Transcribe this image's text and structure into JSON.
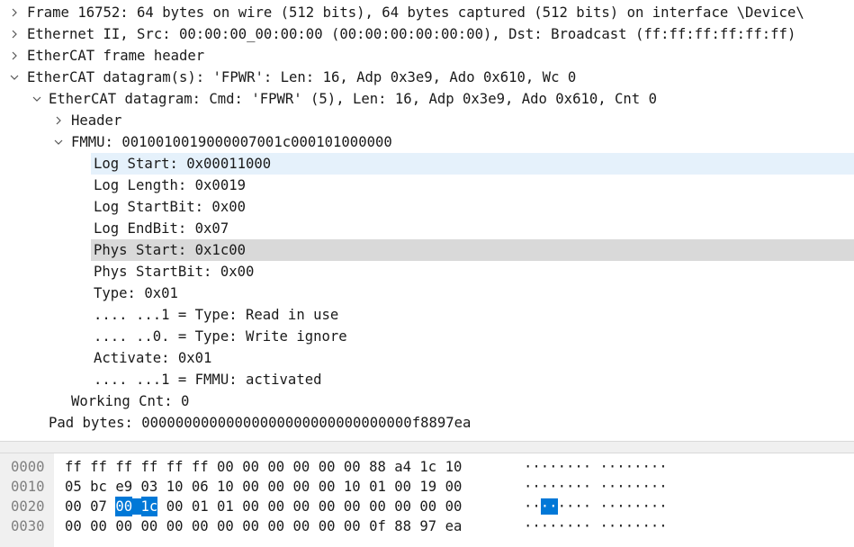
{
  "tree": [
    {
      "text": "Frame 16752: 64 bytes on wire (512 bits), 64 bytes captured (512 bits) on interface \\Device\\",
      "indent": 0,
      "arrow": "collapsed"
    },
    {
      "text": "Ethernet II, Src: 00:00:00_00:00:00 (00:00:00:00:00:00), Dst: Broadcast (ff:ff:ff:ff:ff:ff)",
      "indent": 0,
      "arrow": "collapsed"
    },
    {
      "text": "EtherCAT frame header",
      "indent": 0,
      "arrow": "collapsed"
    },
    {
      "text": "EtherCAT datagram(s): 'FPWR': Len: 16, Adp 0x3e9, Ado 0x610, Wc 0",
      "indent": 0,
      "arrow": "expanded"
    },
    {
      "text": "EtherCAT datagram: Cmd: 'FPWR' (5), Len: 16, Adp 0x3e9, Ado 0x610, Cnt 0",
      "indent": 1,
      "arrow": "expanded"
    },
    {
      "text": "Header",
      "indent": 2,
      "arrow": "collapsed"
    },
    {
      "text": "FMMU: 0010010019000007001c000101000000",
      "indent": 2,
      "arrow": "expanded"
    },
    {
      "text": "Log Start: 0x00011000",
      "indent": 3,
      "arrow": "none",
      "highlight": "blue"
    },
    {
      "text": "Log Length: 0x0019",
      "indent": 3,
      "arrow": "none"
    },
    {
      "text": "Log StartBit: 0x00",
      "indent": 3,
      "arrow": "none"
    },
    {
      "text": "Log EndBit: 0x07",
      "indent": 3,
      "arrow": "none"
    },
    {
      "text": "Phys Start: 0x1c00",
      "indent": 3,
      "arrow": "none",
      "highlight": "gray"
    },
    {
      "text": "Phys StartBit: 0x00",
      "indent": 3,
      "arrow": "none"
    },
    {
      "text": "Type: 0x01",
      "indent": 3,
      "arrow": "none"
    },
    {
      "text": ".... ...1 = Type: Read in use",
      "indent": 3,
      "arrow": "none"
    },
    {
      "text": ".... ..0. = Type: Write ignore",
      "indent": 3,
      "arrow": "none"
    },
    {
      "text": "Activate: 0x01",
      "indent": 3,
      "arrow": "none"
    },
    {
      "text": ".... ...1 = FMMU: activated",
      "indent": 3,
      "arrow": "none"
    },
    {
      "text": "Working Cnt: 0",
      "indent": 2,
      "arrow": "none"
    },
    {
      "text": "Pad bytes: 00000000000000000000000000000000f8897ea",
      "indent": 1,
      "arrow": "none"
    }
  ],
  "bytes": [
    {
      "offset": "0000",
      "hex": [
        "ff",
        "ff",
        "ff",
        "ff",
        "ff",
        "ff",
        "00",
        "00",
        "00",
        "00",
        "00",
        "00",
        "88",
        "a4",
        "1c",
        "10"
      ],
      "ascii": "········ ········",
      "sel": []
    },
    {
      "offset": "0010",
      "hex": [
        "05",
        "bc",
        "e9",
        "03",
        "10",
        "06",
        "10",
        "00",
        "00",
        "00",
        "00",
        "10",
        "01",
        "00",
        "19",
        "00"
      ],
      "ascii": "········ ········",
      "sel": []
    },
    {
      "offset": "0020",
      "hex": [
        "00",
        "07",
        "00",
        "1c",
        "00",
        "01",
        "01",
        "00",
        "00",
        "00",
        "00",
        "00",
        "00",
        "00",
        "00",
        "00"
      ],
      "ascii": "········ ········",
      "sel": [
        2,
        3
      ]
    },
    {
      "offset": "0030",
      "hex": [
        "00",
        "00",
        "00",
        "00",
        "00",
        "00",
        "00",
        "00",
        "00",
        "00",
        "00",
        "00",
        "0f",
        "88",
        "97",
        "ea"
      ],
      "ascii": "········ ········",
      "sel": []
    }
  ],
  "colors": {
    "selection": "#0078d7",
    "hover": "#e5f1fb",
    "related": "#d9d9d9"
  }
}
